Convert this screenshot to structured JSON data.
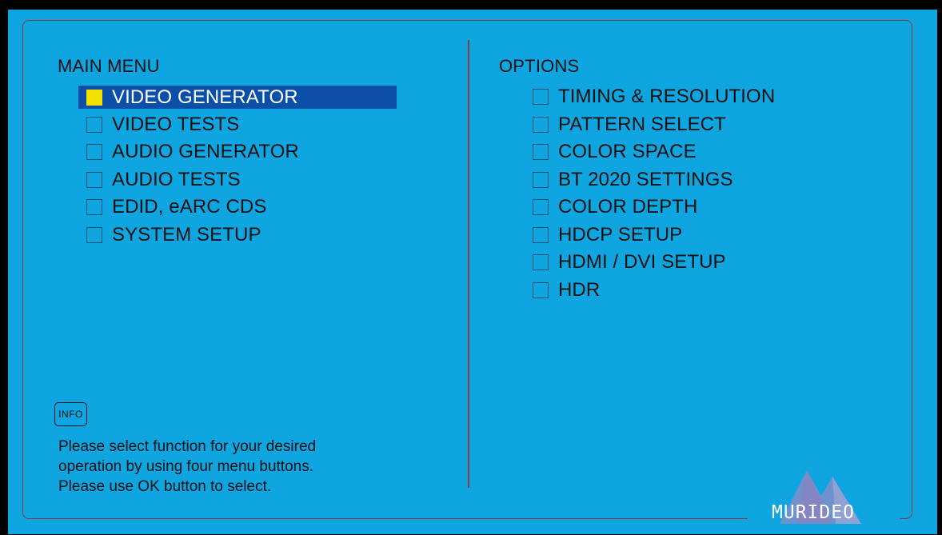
{
  "main_menu": {
    "title": "MAIN MENU",
    "items": [
      {
        "label": "VIDEO GENERATOR",
        "selected": true
      },
      {
        "label": "VIDEO TESTS",
        "selected": false
      },
      {
        "label": "AUDIO GENERATOR",
        "selected": false
      },
      {
        "label": "AUDIO TESTS",
        "selected": false
      },
      {
        "label": "EDID, eARC CDS",
        "selected": false
      },
      {
        "label": "SYSTEM SETUP",
        "selected": false
      }
    ]
  },
  "options": {
    "title": "OPTIONS",
    "items": [
      {
        "label": "TIMING & RESOLUTION"
      },
      {
        "label": "PATTERN SELECT"
      },
      {
        "label": "COLOR SPACE"
      },
      {
        "label": "BT 2020 SETTINGS"
      },
      {
        "label": "COLOR DEPTH"
      },
      {
        "label": "HDCP SETUP"
      },
      {
        "label": "HDMI / DVI SETUP"
      },
      {
        "label": "HDR"
      }
    ]
  },
  "info": {
    "button_label": "INFO",
    "help_lines": [
      "Please select function for your desired",
      "operation by using four menu buttons.",
      "Please use OK button to select."
    ]
  },
  "brand": {
    "logo_text": "MURIDEO",
    "logo_icon": "murideo-mountain-logo"
  },
  "colors": {
    "background": "#0EA5E0",
    "frame": "#8C3A3A",
    "selection": "#0C4FA8",
    "selection_marker": "#F3E200"
  }
}
